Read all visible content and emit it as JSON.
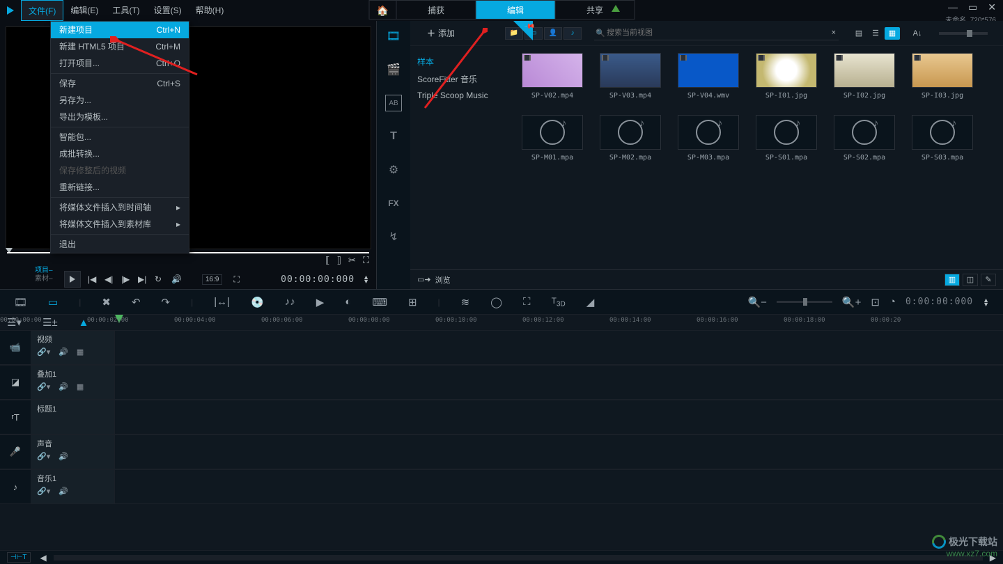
{
  "menubar": {
    "file": "文件(F)",
    "edit": "编辑(E)",
    "tools": "工具(T)",
    "settings": "设置(S)",
    "help": "帮助(H)"
  },
  "main_tabs": {
    "capture": "捕获",
    "editing": "编辑",
    "share": "共享"
  },
  "status": "未命名, 720*576",
  "file_menu": {
    "new_project": "新建项目",
    "new_project_key": "Ctrl+N",
    "new_html5": "新建 HTML5 项目",
    "new_html5_key": "Ctrl+M",
    "open_project": "打开项目...",
    "open_project_key": "Ctrl+O",
    "save": "保存",
    "save_key": "Ctrl+S",
    "save_as": "另存为...",
    "export_template": "导出为模板...",
    "smart_pack": "智能包...",
    "batch_convert": "成批转换...",
    "save_trimmed": "保存修整后的视频",
    "relink": "重新链接...",
    "insert_timeline": "将媒体文件插入到时间轴",
    "insert_library": "将媒体文件插入到素材库",
    "exit": "退出"
  },
  "preview": {
    "proj_label": "项目–",
    "clip_label": "素材–",
    "aspect": "16:9",
    "timecode": "00:00:00:000"
  },
  "library": {
    "add": "添加",
    "tree": {
      "samples": "样本",
      "scorefitter": "ScoreFitter 音乐",
      "triplescoop": "Triple Scoop Music"
    },
    "search_placeholder": "搜索当前视图",
    "thumbs": [
      {
        "name": "SP-V02.mp4",
        "bg": "linear-gradient(45deg,#b989d6,#d4b3ea)"
      },
      {
        "name": "SP-V03.mp4",
        "bg": "linear-gradient(#3a5a8a,#2a3a5a)"
      },
      {
        "name": "SP-V04.wmv",
        "bg": "#0858c8"
      },
      {
        "name": "SP-I01.jpg",
        "bg": "radial-gradient(circle,#fff 30%,#c4b870 70%)"
      },
      {
        "name": "SP-I02.jpg",
        "bg": "linear-gradient(#e8e4d0,#b8b090)"
      },
      {
        "name": "SP-I03.jpg",
        "bg": "linear-gradient(#e8c890,#c89850)"
      }
    ],
    "audio": [
      "SP-M01.mpa",
      "SP-M02.mpa",
      "SP-M03.mpa",
      "SP-S01.mpa",
      "SP-S02.mpa",
      "SP-S03.mpa"
    ],
    "browse": "浏览"
  },
  "timeline": {
    "timecode": "0:00:00:000",
    "ticks": [
      "00:00:00:00",
      "00:00:02:00",
      "00:00:04:00",
      "00:00:06:00",
      "00:00:08:00",
      "00:00:10:00",
      "00:00:12:00",
      "00:00:14:00",
      "00:00:16:00",
      "00:00:18:00",
      "00:00:20"
    ],
    "tracks": {
      "video": "视频",
      "overlay": "叠加1",
      "title": "标题1",
      "voice": "声音",
      "music": "音乐1"
    }
  },
  "watermark": {
    "brand": "极光下载站",
    "url": "www.xz7.com"
  }
}
